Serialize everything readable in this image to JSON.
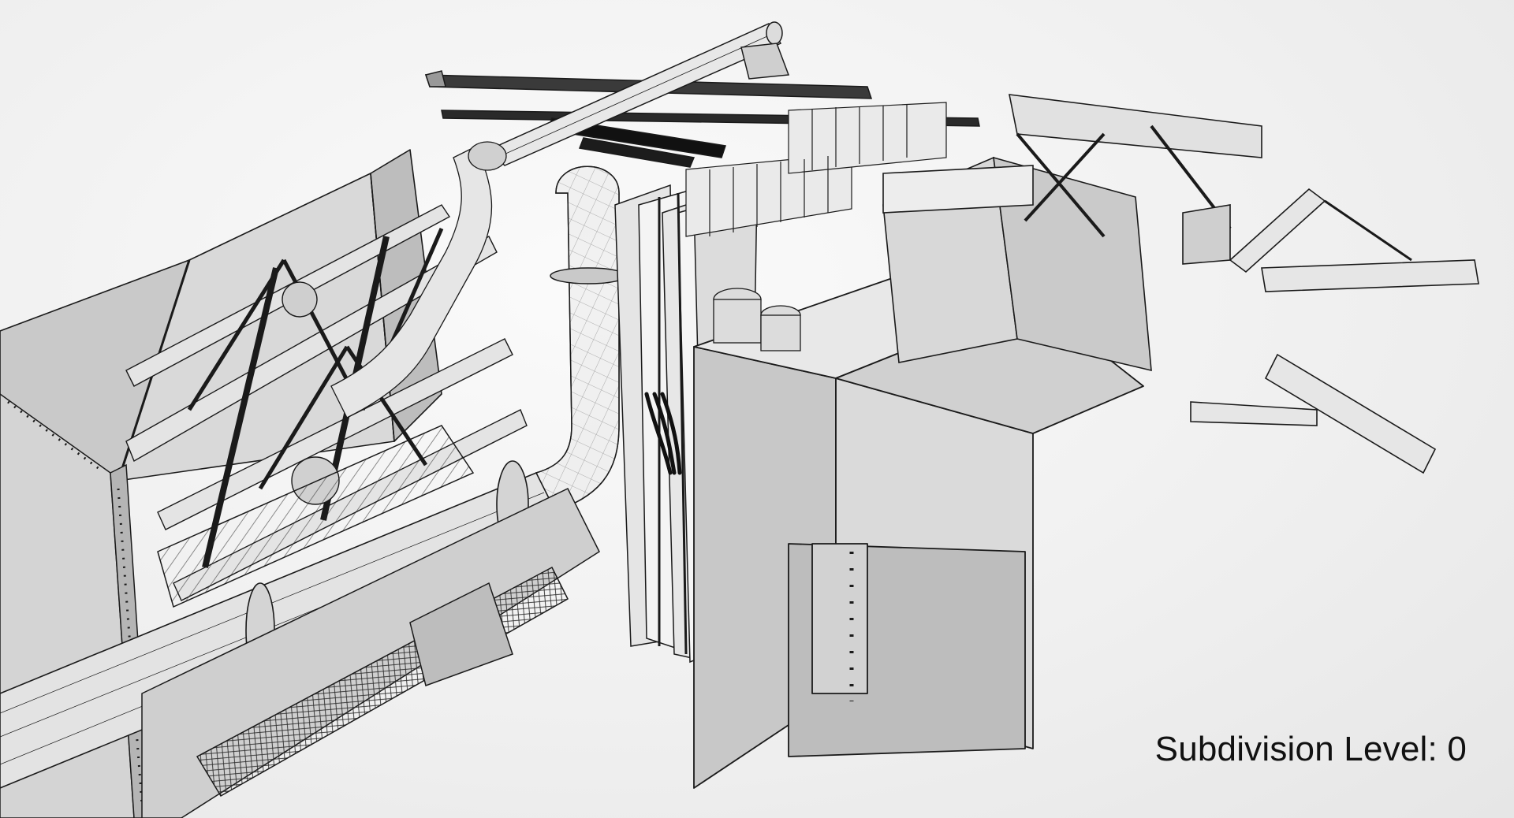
{
  "viewport": {
    "overlay_text": "Subdivision Level: 0"
  },
  "colors": {
    "background": "#f2f2f2",
    "surface_light": "#e6e6e6",
    "surface_mid": "#cfcfcf",
    "surface_dark": "#a9a9a9",
    "wire": "#1a1a1a",
    "overlay_text": "#111111"
  }
}
